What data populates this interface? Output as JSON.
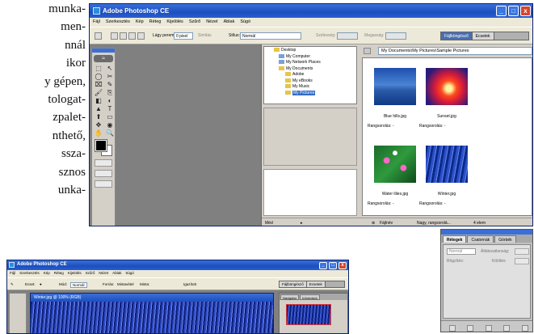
{
  "page_text": {
    "lines": [
      "munka-",
      "men-",
      "nnál",
      "ikor",
      "y gépen,",
      "tologat-",
      "zpalet-",
      "nthető,",
      "ssza-",
      "sznos",
      "unka-"
    ]
  },
  "main_window": {
    "title": "Adobe Photoshop CE",
    "window_buttons": [
      "_",
      "□",
      "x"
    ],
    "menu": [
      "Fájl",
      "Szerkesztés",
      "Kép",
      "Réteg",
      "Kijelölés",
      "Szűrő",
      "Nézet",
      "Ablak",
      "Súgó"
    ],
    "options": {
      "feather_label": "Lágy perem:",
      "feather_value": "0 pixel",
      "antialias_label": "Simítás",
      "style_label": "Stílus:",
      "style_value": "Normál",
      "width_label": "Szélesség:",
      "height_label": "Magasság:"
    },
    "palette_well_tabs": [
      "Fájlböngésző",
      "Ecsetek"
    ],
    "toolbox": {
      "tools": [
        "⬚",
        "↖",
        "◯",
        "✂",
        "⌧",
        "✎",
        "🖌",
        "⎘",
        "◧",
        "◐",
        "▲",
        "T",
        "⬆",
        "▭",
        "✥",
        "◉",
        "✋",
        "🔍"
      ]
    },
    "file_browser": {
      "tree": [
        {
          "label": "Desktop",
          "icon": "folder-icon"
        },
        {
          "label": "My Computer",
          "icon": "computer-icon"
        },
        {
          "label": "My Network Places",
          "icon": "network-icon"
        },
        {
          "label": "My Documents",
          "icon": "folder-icon"
        },
        {
          "label": "Adobe",
          "icon": "folder-icon"
        },
        {
          "label": "My eBooks",
          "icon": "folder-icon"
        },
        {
          "label": "My Music",
          "icon": "folder-icon"
        },
        {
          "label": "My Pictures",
          "icon": "folder-icon",
          "selected": true
        }
      ],
      "status_left": "Méd",
      "path": "My Documents\\My Pictures\\Sample Pictures",
      "thumbnails": [
        {
          "name": "Blue hills.jpg",
          "rank": "Rangsorolás: -",
          "style": "img-bluehills"
        },
        {
          "name": "Sunset.jpg",
          "rank": "Rangsorolás: -",
          "style": "img-sunset"
        },
        {
          "name": "Water lilies.jpg",
          "rank": "Rangsorolás: -",
          "style": "img-lilies"
        },
        {
          "name": "Winter.jpg",
          "rank": "Rangsorolás: -",
          "style": "img-winter"
        }
      ],
      "status_right": {
        "view": "Fájlnév",
        "size": "Nagy, rangsorolá...",
        "count": "4 elem"
      }
    }
  },
  "history_palette": {
    "tabs": [
      "Rétegek",
      "Csatornák",
      "Görbék"
    ],
    "blend_mode": "Normál",
    "opacity_label": "Átlátszatlanság:",
    "lock_label": "Rögzítés:",
    "fill_label": "Kitöltés:"
  },
  "second_window": {
    "title": "Adobe Photoshop CE",
    "menu": [
      "Fájl",
      "Szerkesztés",
      "Kép",
      "Réteg",
      "Kijelölés",
      "Szűrő",
      "Nézet",
      "Ablak",
      "Súgó"
    ],
    "options": {
      "brush_label": "Ecset:",
      "mode_label": "Mód:",
      "mode_value": "Normál",
      "forms_label": "Forrás:",
      "sampled_label": "Mintavétel",
      "pattern_label": "Minta:",
      "aligned_label": "Igazított"
    },
    "palette_well_tabs": [
      "Fájlböngésző",
      "Ecsetek"
    ],
    "document_title": "Winter.jpg @ 100% (RGB)",
    "navigator_tabs": [
      "Navigátor",
      "Információ"
    ]
  }
}
